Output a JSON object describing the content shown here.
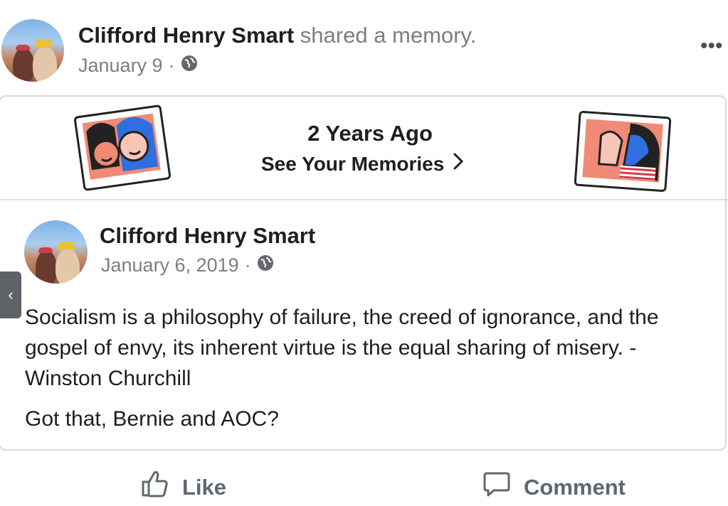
{
  "header": {
    "author": "Clifford Henry Smart",
    "action_text": "shared a memory.",
    "date": "January 9",
    "separator": "·",
    "privacy_icon": "globe-icon",
    "more_icon": "more-dots-icon",
    "more_label": "•••"
  },
  "memory": {
    "title": "2 Years Ago",
    "link_label": "See Your Memories",
    "link_icon": "chevron-right-icon"
  },
  "post": {
    "author": "Clifford Henry Smart",
    "date": "January 6, 2019",
    "separator": "·",
    "privacy_icon": "globe-icon",
    "paragraphs": [
      "Socialism is a philosophy of failure, the creed of ignorance, and the gospel of envy, its inherent virtue is the equal sharing of misery. - Winston Churchill",
      "Got that, Bernie and AOC?"
    ]
  },
  "side_tab": {
    "icon": "chevron-left-icon",
    "label": "‹"
  },
  "actions": [
    {
      "label": "Like",
      "icon": "thumbs-up-icon"
    },
    {
      "label": "Comment",
      "icon": "comment-bubble-icon"
    }
  ],
  "colors": {
    "text": "#1c1e21",
    "secondary": "#7a7f86",
    "border": "#d6d9dd",
    "action": "#606770",
    "polaroid_face": "#f08a75",
    "polaroid_blue": "#2f6fe0"
  }
}
